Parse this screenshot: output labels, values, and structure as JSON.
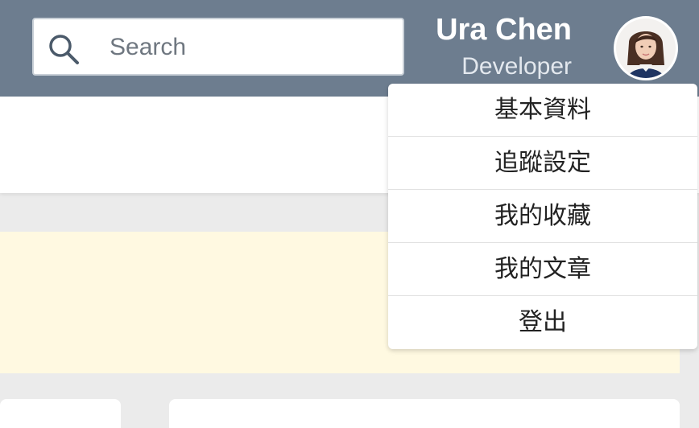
{
  "header": {
    "search": {
      "placeholder": "Search",
      "value": ""
    },
    "user": {
      "name": "Ura Chen",
      "role": "Developer"
    },
    "colors": {
      "bar": "#6d7d8f",
      "panel": "#fff9e1"
    }
  },
  "icons": {
    "search": "search-icon",
    "avatar": "avatar-photo"
  },
  "dropdown": {
    "items": [
      {
        "label": "基本資料"
      },
      {
        "label": "追蹤設定"
      },
      {
        "label": "我的收藏"
      },
      {
        "label": "我的文章"
      },
      {
        "label": "登出"
      }
    ]
  }
}
